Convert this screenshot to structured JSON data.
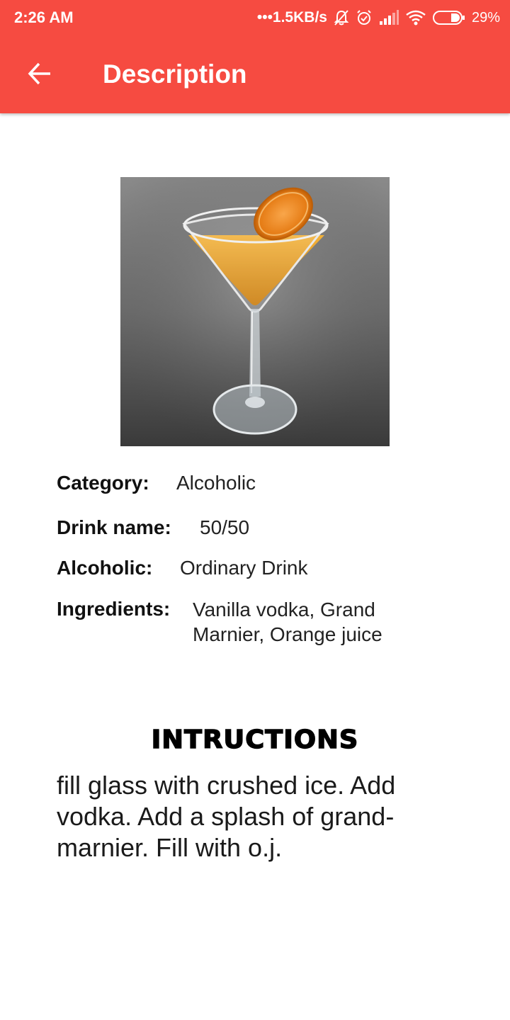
{
  "status_bar": {
    "time": "2:26 AM",
    "network_speed": "1.5KB/s",
    "battery_percent": "29%",
    "icons": [
      "mute-icon",
      "alarm-icon",
      "signal-icon",
      "wifi-icon",
      "battery-icon"
    ]
  },
  "app_bar": {
    "back_icon": "arrow-left-icon",
    "title": "Description",
    "color": "#f64b41"
  },
  "drink": {
    "image": "cocktail-photo",
    "category_label": "Category:",
    "category_value": "Alcoholic",
    "name_label": "Drink name:",
    "name_value": "50/50",
    "alcoholic_label": "Alcoholic:",
    "alcoholic_value": "Ordinary Drink",
    "ingredients_label": "Ingredients:",
    "ingredients_value": "Vanilla vodka, Grand Marnier, Orange juice"
  },
  "instructions": {
    "heading": "INTRUCTIONS",
    "text": "fill glass with crushed ice. Add vodka. Add a splash of grand-marnier. Fill with o.j."
  }
}
